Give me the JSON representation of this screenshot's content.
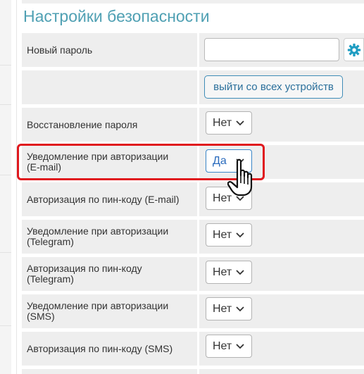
{
  "security": {
    "title": "Настройки безопасности",
    "new_password_label": "Новый пароль",
    "new_password_value": "",
    "logout_all_button": "выйти со всех устройств",
    "settings": [
      {
        "label_line1": "Восстановление пароля",
        "label_line2": "",
        "value": "Нет"
      },
      {
        "label_line1": "Уведомление при авторизации",
        "label_line2": "(E-mail)",
        "value": "Да"
      },
      {
        "label_line1": "Авторизация по пин-коду (E-mail)",
        "label_line2": "",
        "value": "Нет"
      },
      {
        "label_line1": "Уведомление при авторизации",
        "label_line2": "(Telegram)",
        "value": "Нет"
      },
      {
        "label_line1": "Авторизация по пин-коду",
        "label_line2": "(Telegram)",
        "value": "Нет"
      },
      {
        "label_line1": "Уведомление при авторизации",
        "label_line2": "(SMS)",
        "value": "Нет"
      },
      {
        "label_line1": "Авторизация по пин-коду (SMS)",
        "label_line2": "",
        "value": "Нет"
      }
    ]
  },
  "icons": {
    "generate_password": "gear-icon",
    "select_arrow": "chevron-down-icon",
    "pointer": "hand-pointer-icon"
  },
  "colors": {
    "title": "#4fa0b3",
    "button_border": "#3f8cb7",
    "highlight": "#e0181e",
    "gear": "#1f9dc2"
  }
}
